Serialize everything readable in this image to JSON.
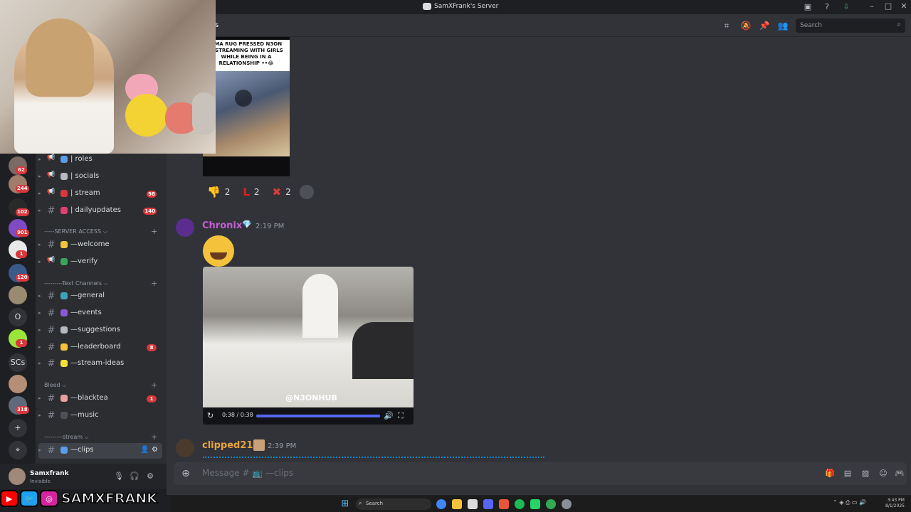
{
  "window": {
    "title": "SamXFrank's Server"
  },
  "header": {
    "channel_fragment": "s",
    "search_placeholder": "Search",
    "icons": [
      "threads-icon",
      "mute-icon",
      "pin-icon",
      "members-icon"
    ]
  },
  "messages": {
    "clip1_caption": "AMA RUG PRESSED N3ON\nR STREAMING WITH GIRLS\nWHILE BEING IN A\nRELATIONSHIP ••😂",
    "reactions": [
      {
        "emoji": "👎",
        "count": "2",
        "color": "#f5c33b"
      },
      {
        "emoji": "L",
        "count": "2",
        "color": "#e02020"
      },
      {
        "emoji": "✖",
        "count": "2",
        "color": "#e03a3a"
      }
    ],
    "msg2": {
      "author": "Chronix",
      "author_color": "#c65dd6",
      "badge": "💎",
      "time": "2:19 PM",
      "video_watermark": "@N3ONHUB",
      "video_time": "0:38 / 0:38",
      "video_progress": 1.0
    },
    "msg3": {
      "author": "clipped211",
      "author_color": "#e7a33e",
      "time": "2:39 PM"
    }
  },
  "composer": {
    "placeholder": "Message # 📺 —clips"
  },
  "servers": [
    {
      "label": "",
      "badge": "62",
      "color": "#7a6a63"
    },
    {
      "label": "",
      "badge": "244",
      "color": "#a07d6a"
    },
    {
      "label": "",
      "badge": "102",
      "color": "#2a2a2a"
    },
    {
      "label": "",
      "badge": "901",
      "color": "#7e4bc2"
    },
    {
      "label": "",
      "badge": "1",
      "color": "#e8e8e8"
    },
    {
      "label": "",
      "badge": "120",
      "color": "#3a5a8a"
    },
    {
      "label": "",
      "badge": "",
      "color": "#9a8a70"
    },
    {
      "label": "O",
      "badge": "",
      "color": "#313338"
    },
    {
      "label": "",
      "badge": "1",
      "color": "#9be43a"
    },
    {
      "label": "SCs",
      "badge": "",
      "color": "#313338"
    },
    {
      "label": "",
      "badge": "",
      "color": "#b58e76"
    },
    {
      "label": "",
      "badge": "318",
      "color": "#5e6a7a"
    },
    {
      "label": "+",
      "badge": "",
      "color": "#313338"
    },
    {
      "label": "⌖",
      "badge": "",
      "color": "#313338"
    }
  ],
  "channels": {
    "top": [
      {
        "kind": "announce",
        "label": "| roles",
        "icon_color": "#5a9de8",
        "badge": ""
      },
      {
        "kind": "announce",
        "label": "| socials",
        "icon_color": "#b5bac1",
        "badge": ""
      },
      {
        "kind": "announce",
        "label": "| stream",
        "icon_color": "#da373c",
        "badge": "98"
      },
      {
        "kind": "text",
        "label": "| dailyupdates",
        "icon_color": "#e04070",
        "badge": "140"
      }
    ],
    "categories": [
      {
        "label": "-----SERVER ACCESS ⌵"
      },
      {
        "label": "---------Text Channels ⌵"
      },
      {
        "label": "Bleed ⌵"
      },
      {
        "label": "---------stream ⌵"
      }
    ],
    "access": [
      {
        "kind": "text",
        "label": "—welcome",
        "icon_color": "#f5c33b",
        "badge": ""
      },
      {
        "kind": "announce",
        "label": "—verify",
        "icon_color": "#3ba55c",
        "badge": ""
      }
    ],
    "text": [
      {
        "kind": "text",
        "label": "—general",
        "icon_color": "#3ba5b5",
        "badge": ""
      },
      {
        "kind": "text",
        "label": "—events",
        "icon_color": "#8a5ad6",
        "badge": ""
      },
      {
        "kind": "text",
        "label": "—suggestions",
        "icon_color": "#b5bac1",
        "badge": ""
      },
      {
        "kind": "text",
        "label": "—leaderboard",
        "icon_color": "#f5c33b",
        "badge": "8"
      },
      {
        "kind": "text",
        "label": "—stream-ideas",
        "icon_color": "#f5e03b",
        "badge": ""
      }
    ],
    "bleed": [
      {
        "kind": "text",
        "label": "—blacktea",
        "icon_color": "#e8a0a0",
        "badge": "1"
      },
      {
        "kind": "text",
        "label": "—music",
        "icon_color": "#4e5058",
        "badge": ""
      }
    ],
    "stream": [
      {
        "kind": "text",
        "label": "—clips",
        "icon_color": "#5a9de8",
        "badge": ""
      }
    ]
  },
  "user": {
    "name": "Samxfrank",
    "status": "Invisible"
  },
  "social_banner": {
    "handle": "SAMXFRANK",
    "icons": [
      "youtube-icon",
      "twitter-icon",
      "instagram-icon"
    ],
    "icon_colors": [
      "#ff0000",
      "#1da1f2",
      "#d6249f"
    ]
  },
  "taskbar": {
    "search": "Search",
    "time": "3:43 PM",
    "date": "8/1/2025"
  }
}
